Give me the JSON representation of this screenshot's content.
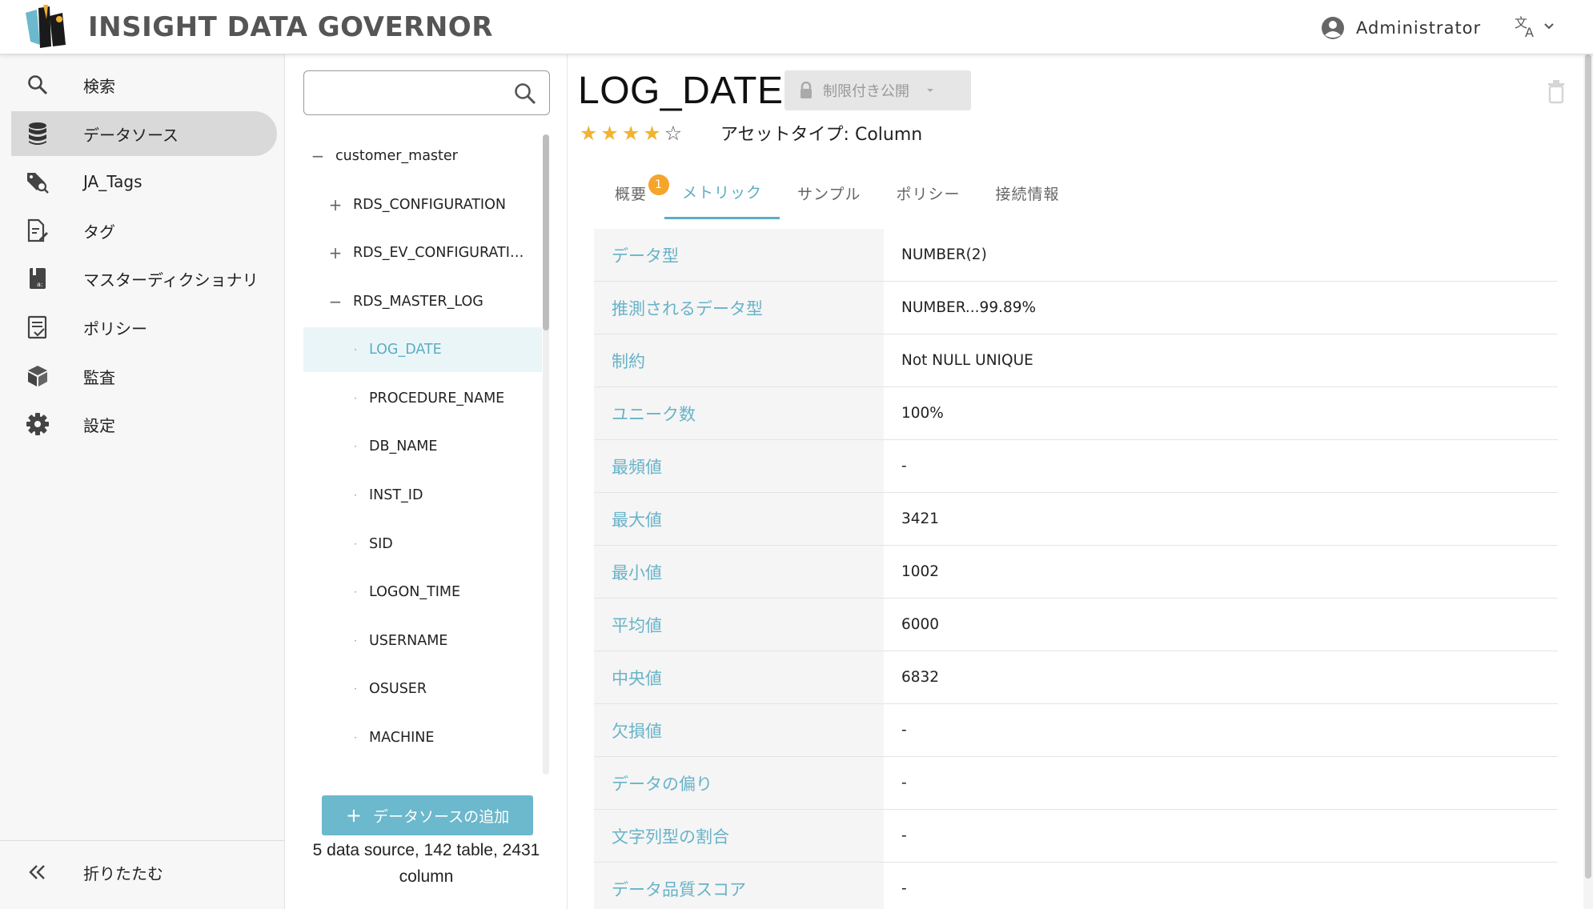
{
  "header": {
    "app_title": "INSIGHT DATA GOVERNOR",
    "user_name": "Administrator"
  },
  "sidebar": {
    "items": [
      {
        "label": "検索",
        "icon": "search-icon"
      },
      {
        "label": "データソース",
        "icon": "database-icon",
        "active": true
      },
      {
        "label": "JA_Tags",
        "icon": "tag-search-icon"
      },
      {
        "label": "タグ",
        "icon": "document-edit-icon"
      },
      {
        "label": "マスターディクショナリ",
        "icon": "dictionary-icon"
      },
      {
        "label": "ポリシー",
        "icon": "policy-icon"
      },
      {
        "label": "監査",
        "icon": "audit-box-icon"
      },
      {
        "label": "設定",
        "icon": "gear-icon"
      }
    ],
    "collapse_label": "折りたたむ"
  },
  "tree": {
    "search": {
      "value": "",
      "placeholder": ""
    },
    "items": [
      {
        "label": "customer_master",
        "toggle": "−",
        "level": 0
      },
      {
        "label": "RDS_CONFIGURATION",
        "toggle": "+",
        "level": 1
      },
      {
        "label": "RDS_EV_CONFIGURATI…",
        "toggle": "+",
        "level": 1
      },
      {
        "label": "RDS_MASTER_LOG",
        "toggle": "−",
        "level": 1
      },
      {
        "label": "LOG_DATE",
        "toggle": "·",
        "level": 2,
        "selected": true
      },
      {
        "label": "PROCEDURE_NAME",
        "toggle": "·",
        "level": 2
      },
      {
        "label": "DB_NAME",
        "toggle": "·",
        "level": 2
      },
      {
        "label": "INST_ID",
        "toggle": "·",
        "level": 2
      },
      {
        "label": "SID",
        "toggle": "·",
        "level": 2
      },
      {
        "label": "LOGON_TIME",
        "toggle": "·",
        "level": 2
      },
      {
        "label": "USERNAME",
        "toggle": "·",
        "level": 2
      },
      {
        "label": "OSUSER",
        "toggle": "·",
        "level": 2
      },
      {
        "label": "MACHINE",
        "toggle": "·",
        "level": 2
      }
    ],
    "add_button_label": "データソースの追加",
    "summary": "5 data source, 142 table, 2431 column"
  },
  "asset": {
    "title": "LOG_DATE",
    "access_label": "制限付き公開",
    "rating": 4,
    "rating_max": 5,
    "asset_type": "アセットタイプ: Column"
  },
  "tabs": [
    {
      "label": "概要",
      "badge": "1"
    },
    {
      "label": "メトリック",
      "active": true
    },
    {
      "label": "サンプル"
    },
    {
      "label": "ポリシー"
    },
    {
      "label": "接続情報"
    }
  ],
  "metrics": [
    {
      "label": "データ型",
      "value": "NUMBER(2)"
    },
    {
      "label": "推測されるデータ型",
      "value": "NUMBER...99.89%"
    },
    {
      "label": "制約",
      "value": "Not NULL UNIQUE"
    },
    {
      "label": "ユニーク数",
      "value": "100%"
    },
    {
      "label": "最頻値",
      "value": "-"
    },
    {
      "label": "最大値",
      "value": "3421"
    },
    {
      "label": "最小値",
      "value": "1002"
    },
    {
      "label": "平均値",
      "value": "6000"
    },
    {
      "label": "中央値",
      "value": "6832"
    },
    {
      "label": "欠損値",
      "value": "-"
    },
    {
      "label": "データの偏り",
      "value": "-"
    },
    {
      "label": "文字列型の割合",
      "value": "-"
    },
    {
      "label": "データ品質スコア",
      "value": "-"
    }
  ],
  "colors": {
    "accent": "#5aaec3",
    "button": "#6cb8cc",
    "star": "#f2b233",
    "badge": "#f5a52a"
  }
}
